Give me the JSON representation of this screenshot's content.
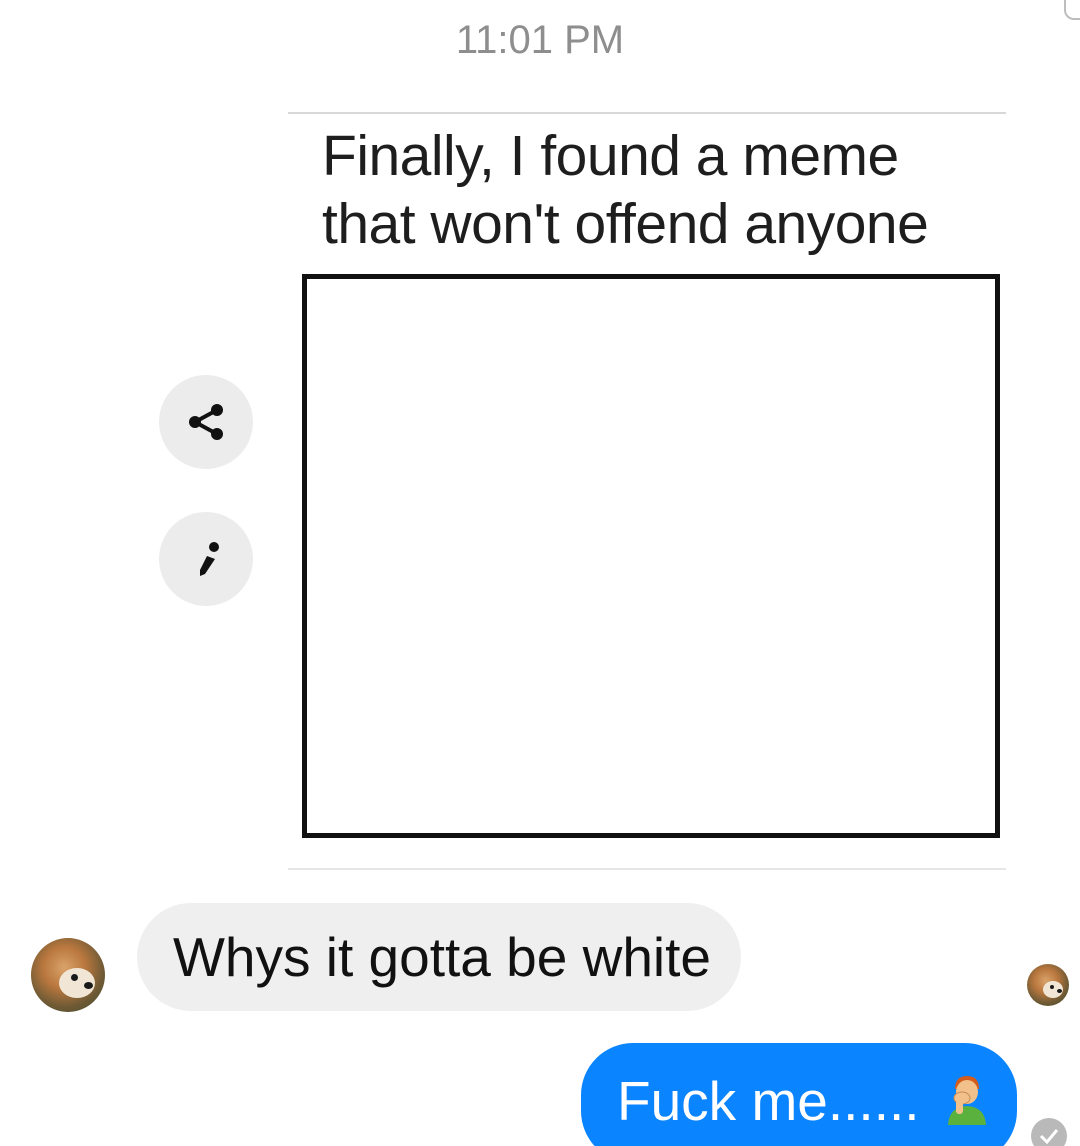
{
  "status": {
    "timestamp": "11:01 PM"
  },
  "meme": {
    "caption": "Finally, I found a meme\nthat won't offend anyone"
  },
  "actions": {
    "share_icon": "share-icon",
    "edit_icon": "pencil-icon"
  },
  "messages": [
    {
      "sender": "other",
      "text": "Whys it gotta be white"
    },
    {
      "sender": "me",
      "text": "Fuck me......",
      "emoji": "man-facepalming"
    }
  ],
  "colors": {
    "outgoing_bubble": "#0b84ff",
    "incoming_bubble": "#efefef",
    "timestamp": "#8e8e8e"
  }
}
